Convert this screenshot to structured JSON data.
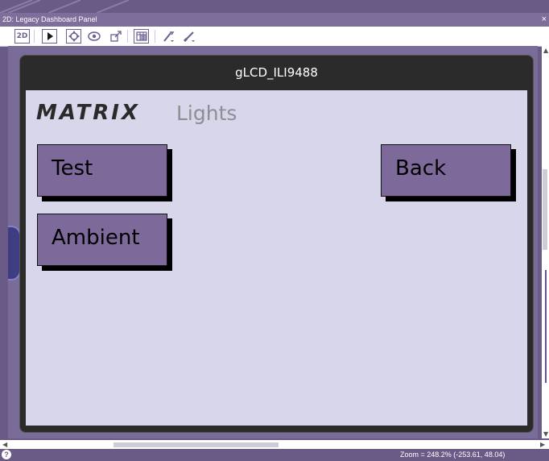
{
  "panel": {
    "title": "2D: Legacy Dashboard Panel",
    "close_glyph": "×"
  },
  "toolbar": {
    "mode_label": "2D",
    "icons": [
      "pointer-icon",
      "move-icon",
      "rotate-icon",
      "scale-icon",
      "grid-icon",
      "wrench-icon",
      "brush-icon"
    ]
  },
  "device": {
    "title": "gLCD_ILI9488",
    "logo": "MATRIX",
    "screen_title": "Lights",
    "buttons": {
      "test": "Test",
      "back": "Back",
      "ambient": "Ambient"
    }
  },
  "status": {
    "help_glyph": "?",
    "zoom_text": "Zoom = 248.2% (-253.61, 48.04)"
  }
}
